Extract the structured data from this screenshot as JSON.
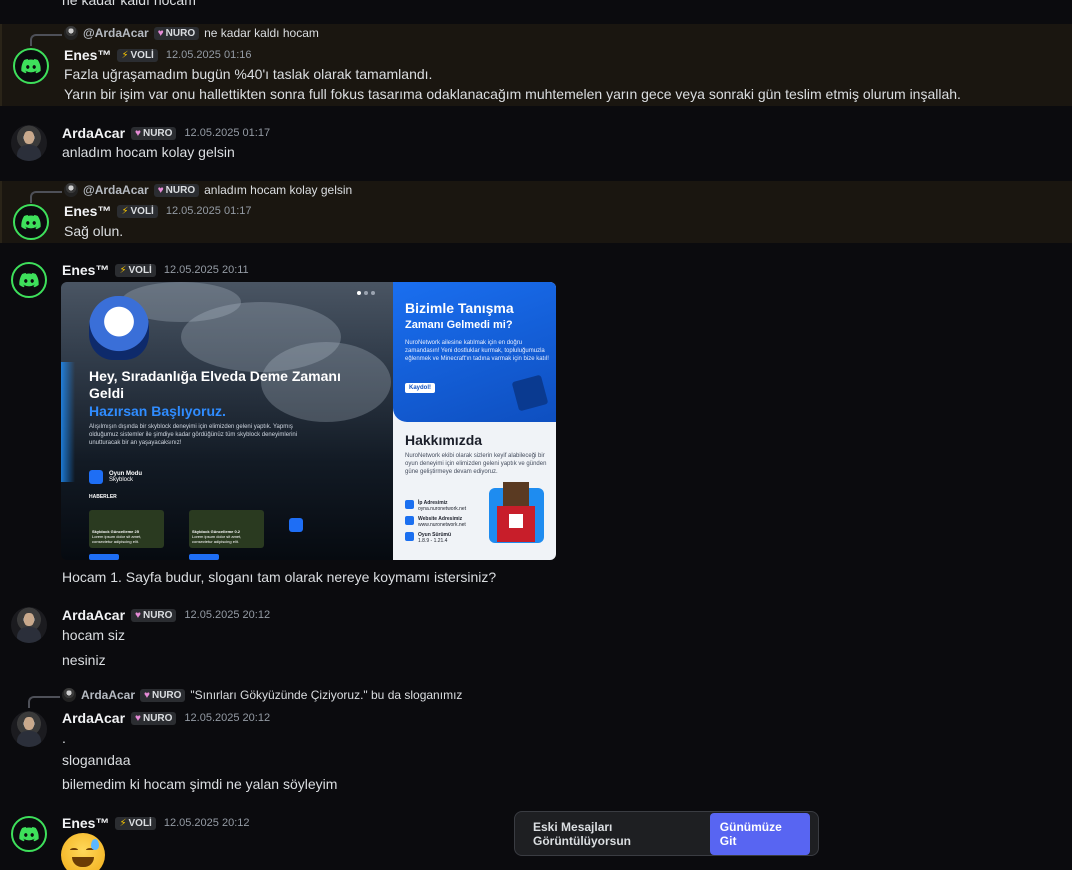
{
  "top_cut_text": "ne kadar kaldı hocam",
  "users": {
    "enes": {
      "name": "Enes™",
      "badge": "VOLİ"
    },
    "arda": {
      "name": "ArdaAcar",
      "badge": "NURO"
    }
  },
  "messages": [
    {
      "reply": {
        "name": "@ArdaAcar",
        "badge": "NURO",
        "text": "ne kadar kaldı hocam"
      },
      "time": "12.05.2025 01:16",
      "lines": [
        "Fazla uğraşamadım bugün %40'ı taslak olarak tamamlandı.",
        "Yarın bir işim var onu hallettikten sonra full fokus tasarıma odaklanacağım muhtemelen yarın gece veya sonraki gün teslim etmiş olurum inşallah."
      ]
    },
    {
      "time": "12.05.2025 01:17",
      "lines": [
        "anladım hocam kolay gelsin"
      ]
    },
    {
      "reply": {
        "name": "@ArdaAcar",
        "badge": "NURO",
        "text": "anladım hocam kolay gelsin"
      },
      "time": "12.05.2025 01:17",
      "lines": [
        "Sağ olun."
      ]
    },
    {
      "time": "12.05.2025 20:11",
      "caption": "Hocam 1. Sayfa budur, sloganı tam olarak nereye koymamı istersiniz?"
    },
    {
      "time": "12.05.2025 20:12",
      "lines": [
        "hocam siz",
        "nesiniz"
      ]
    },
    {
      "reply": {
        "name": "ArdaAcar",
        "badge": "NURO",
        "text": "\"Sınırları Gökyüzünde Çiziyoruz.\" bu da sloganımız"
      },
      "time": "12.05.2025 20:12",
      "lines": [
        ".",
        "sloganıdaa",
        "bilemedim ki hocam şimdi ne yalan söyleyim"
      ]
    },
    {
      "time": "12.05.2025 20:12"
    }
  ],
  "attachment": {
    "left_title": "Hey, Sıradanlığa Elveda Deme Zamanı Geldi",
    "left_sub": "Hazırsan Başlıyoruz.",
    "left_desc": "Alışılmışın dışında bir skyblock deneyimi için elimizden geleni yaptık. Yapmış olduğumuz sistemler ile şimdiye kadar gördüğünüz tüm skyblock deneyimlerini unutturacak bir an yaşayacaksınız!",
    "mode_label": "Oyun Modu",
    "mode_value": "Skyblock",
    "news_label": "HABERLER",
    "news_1": "Skyblock Güncelleme 25",
    "news_2": "Skyblock Güncelleme 0.2",
    "news_desc": "Lorem ipsum dolor sit amet, consectetur adipiscing elit.",
    "right_title": "Bizimle Tanışma",
    "right_title2": "Zamanı Gelmedi mi?",
    "right_desc": "NuroNetwork ailesine katılmak için en doğru zamandasın! Yeni dostluklar kurmak, topluluğumuzla eğlenmek ve Minecraft'ın tadına varmak için bize katıl!",
    "join_label": "Kaydol!",
    "about_title": "Hakkımızda",
    "about_desc": "NuroNetwork ekibi olarak sizlerin keyif alabileceği bir oyun deneyimi için elimizden geleni yaptık ve günden güne geliştirmeye devam ediyoruz.",
    "ip_label": "İp Adresimiz",
    "ip_value": "oyna.nuronetwork.net",
    "web_label": "Website Adresimiz",
    "web_value": "www.nuronetwork.net",
    "version_label": "Oyun Sürümü",
    "version_value": "1.8.9 - 1.21.4"
  },
  "old_messages_bar": {
    "label": "Eski Mesajları Görüntülüyorsun",
    "button": "Günümüze Git"
  },
  "colors": {
    "accent": "#5865f2",
    "discord_ring": "#3ee05b",
    "mention_bg": "#1a1610"
  }
}
